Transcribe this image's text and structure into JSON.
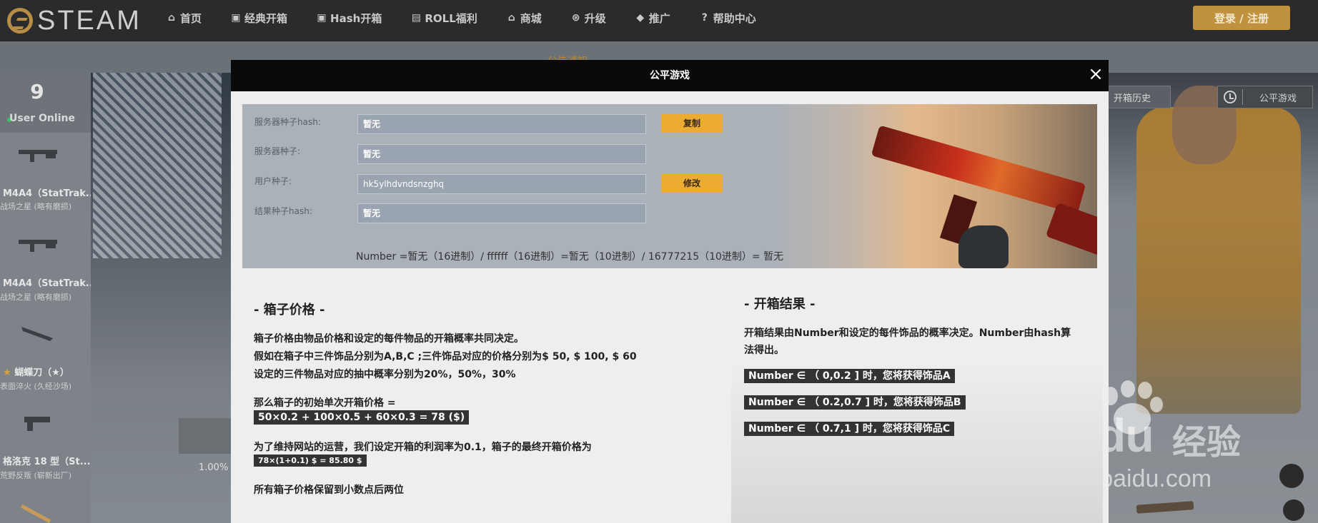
{
  "brand": {
    "name": "STEAM",
    "accent": "#c0923f"
  },
  "nav": {
    "items": [
      {
        "icon": "home-icon",
        "label": "首页"
      },
      {
        "icon": "box-icon",
        "label": "经典开箱"
      },
      {
        "icon": "hash-icon",
        "label": "Hash开箱"
      },
      {
        "icon": "gift-icon",
        "label": "ROLL福利"
      },
      {
        "icon": "shop-icon",
        "label": "商城"
      },
      {
        "icon": "upgrade-icon",
        "label": "升级"
      },
      {
        "icon": "share-icon",
        "label": "推广"
      },
      {
        "icon": "help-icon",
        "label": "帮助中心"
      }
    ],
    "login_label": "登录 / 注册"
  },
  "notice": {
    "text": "公告通知"
  },
  "sidebar": {
    "online_count": "9",
    "online_label": "User Online",
    "drops": [
      {
        "name": "M4A4（StatTrak...",
        "sub": "战场之星 (略有磨损)"
      },
      {
        "name": "M4A4（StatTrak...",
        "sub": "战场之星 (略有磨损)"
      },
      {
        "name": "蝴蝶刀（★）",
        "sub": "表面淬火 (久经沙场)"
      },
      {
        "name": "格洛克 18 型（St...",
        "sub": "荒野反叛 (崭新出厂)"
      }
    ]
  },
  "background": {
    "percent_text": "1.00%"
  },
  "right_buttons": {
    "history_label": "开箱历史",
    "fair_label": "公平游戏"
  },
  "watermark": {
    "brand": "Bai du",
    "brand_cn": "经验",
    "url": "jingyan.baidu.com"
  },
  "modal": {
    "title": "公平游戏",
    "close_glyph": "×",
    "seeds": {
      "server_hash_label": "服务器种子hash:",
      "server_hash_value": "暂无",
      "copy_label": "复制",
      "server_seed_label": "服务器种子:",
      "server_seed_value": "暂无",
      "user_seed_label": "用户种子:",
      "user_seed_value": "hk5ylhdvndsnzghq",
      "modify_label": "修改",
      "result_hash_label": "结果种子hash:",
      "result_hash_value": "暂无",
      "formula": "Number =暂无（16进制）/ ffffff（16进制）=暂无（10进制）/ 16777215（10进制）= 暂无"
    },
    "price": {
      "title": "- 箱子价格 -",
      "line1": "箱子价格由物品价格和设定的每件物品的开箱概率共同决定。",
      "line2": "假如在箱子中三件饰品分别为A,B,C ;三件饰品对应的价格分别为$ 50, $ 100, $ 60",
      "line3": "设定的三件物品对应的抽中概率分别为20%，50%，30%",
      "line4": "那么箱子的初始单次开箱价格 =",
      "calc1": "50×0.2 + 100×0.5 + 60×0.3 = 78 ($)",
      "line5": "为了维持网站的运营，我们设定开箱的利润率为0.1，箱子的最终开箱价格为",
      "calc2": "78×(1+0.1)  $ = 85.80 $",
      "line6": "所有箱子价格保留到小数点后两位"
    },
    "result": {
      "title": "- 开箱结果 -",
      "desc1": "开箱结果由Number和设定的每件饰品的概率决定。Number由hash算",
      "desc2": "法得出。",
      "rule1": "Number ∈ （ 0,0.2 ] 时，您将获得饰品A",
      "rule2": "Number ∈ （ 0.2,0.7 ] 时，您将获得饰品B",
      "rule3": "Number ∈ （ 0.7,1 ] 时，您将获得饰品C"
    }
  }
}
